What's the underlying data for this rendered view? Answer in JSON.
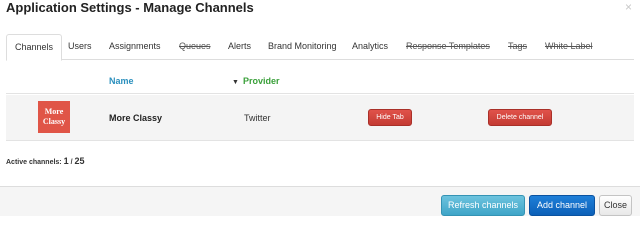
{
  "dialog": {
    "title": "Application Settings - Manage Channels",
    "close_icon": "×"
  },
  "tabs": [
    {
      "label": "Channels",
      "active": true,
      "strikethrough": false
    },
    {
      "label": "Users",
      "active": false,
      "strikethrough": false
    },
    {
      "label": "Assignments",
      "active": false,
      "strikethrough": false
    },
    {
      "label": "Queues",
      "active": false,
      "strikethrough": true
    },
    {
      "label": "Alerts",
      "active": false,
      "strikethrough": false
    },
    {
      "label": "Brand Monitoring",
      "active": false,
      "strikethrough": false
    },
    {
      "label": "Analytics",
      "active": false,
      "strikethrough": false
    },
    {
      "label": "Response Templates",
      "active": false,
      "strikethrough": true
    },
    {
      "label": "Tags",
      "active": false,
      "strikethrough": true
    },
    {
      "label": "White Label",
      "active": false,
      "strikethrough": true
    }
  ],
  "table": {
    "columns": {
      "name": "Name",
      "provider": "Provider",
      "sort_icon": "▼"
    },
    "rows": [
      {
        "avatar_text": "More Classy",
        "name": "More Classy",
        "provider": "Twitter",
        "hide_label": "Hide Tab",
        "delete_label": "Delete channel"
      }
    ]
  },
  "active_channels": {
    "label": "Active channels:",
    "count": "1",
    "separator": "/",
    "total": "25"
  },
  "footer": {
    "refresh_label": "Refresh channels",
    "add_label": "Add channel",
    "close_label": "Close"
  },
  "colors": {
    "accent_blue": "#0c60b8",
    "refresh_teal": "#3fa5c8",
    "danger_red": "#c43b33",
    "name_header": "#2a8fbd",
    "provider_header": "#3aa03a",
    "avatar_bg": "#e05547"
  }
}
